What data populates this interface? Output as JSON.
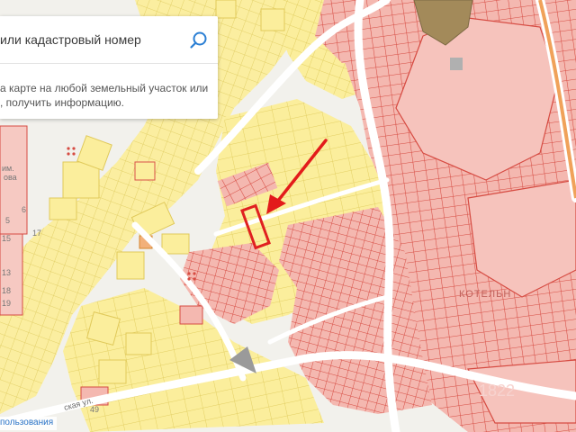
{
  "search": {
    "placeholder": "или кадастровый номер",
    "hint_line1": "а карте на любой земельный участок или",
    "hint_line2": ", получить информацию."
  },
  "map_labels": {
    "district": "КОТЕЛЬН",
    "street": "ская ул.",
    "parcel_49": "49",
    "label_6": "6",
    "label_5": "5",
    "label_17": "17",
    "label_13": "13",
    "label_18": "18",
    "label_19": "19",
    "label_15": "15",
    "label_im": "им.",
    "label_ova": "ова",
    "watermark": "1822"
  },
  "footer": {
    "usage_link": "пользования"
  },
  "colors": {
    "background": "#f2f1ec",
    "road": "#ffffff",
    "yellow_parcel_fill": "#fbee9c",
    "yellow_parcel_stroke": "#e0c95a",
    "red_parcel_fill": "#f2b2aa",
    "red_parcel_stroke": "#d9534a",
    "highlight": "#e02020",
    "arrow": "#e31b1b",
    "search_icon": "#2b7fd4"
  },
  "icons": {
    "search": "magnifier-icon"
  }
}
